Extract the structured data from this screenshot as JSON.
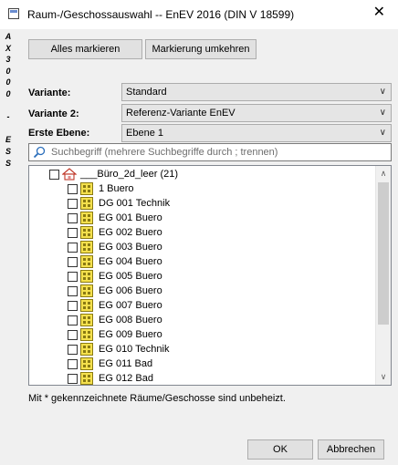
{
  "window": {
    "title": "Raum-/Geschossauswahl -- EnEV 2016 (DIN V 18599)",
    "close": "✕"
  },
  "sidebar_text": [
    "A",
    "X",
    "3",
    "0",
    "0",
    "0",
    "",
    "-",
    "",
    "E",
    "S",
    "S"
  ],
  "toolbar": {
    "mark_all": "Alles markieren",
    "invert": "Markierung umkehren"
  },
  "form": {
    "variante_label": "Variante:",
    "variante_value": "Standard",
    "variante2_label": "Variante 2:",
    "variante2_value": "Referenz-Variante EnEV",
    "ebene_label": "Erste Ebene:",
    "ebene_value": "Ebene 1"
  },
  "search": {
    "placeholder": "Suchbegriff (mehrere Suchbegriffe durch ; trennen)"
  },
  "tree": {
    "root": "___Büro_2d_leer (21)",
    "items": [
      "1  Buero",
      "DG 001 Technik",
      "EG 001  Buero",
      "EG 002  Buero",
      "EG 003  Buero",
      "EG 004  Buero",
      "EG 005  Buero",
      "EG 006  Buero",
      "EG 007  Buero",
      "EG 008  Buero",
      "EG 009  Buero",
      "EG 010 Technik",
      "EG 011  Bad",
      "EG 012  Bad"
    ]
  },
  "note": "Mit * gekennzeichnete Räume/Geschosse sind unbeheizt.",
  "footer": {
    "ok": "OK",
    "cancel": "Abbrechen"
  }
}
